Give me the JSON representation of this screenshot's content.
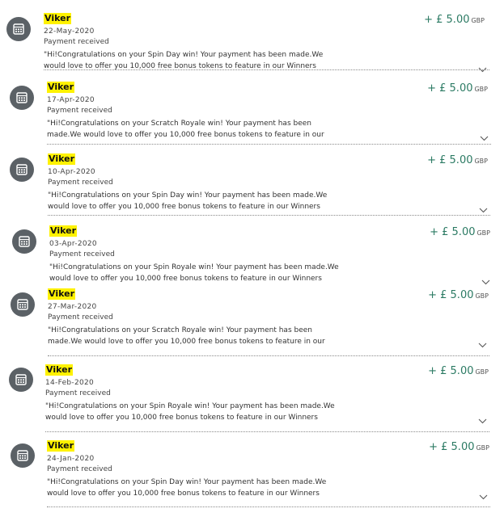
{
  "transactions": [
    {
      "payee": "Viker",
      "date": "22-May-2020",
      "type": "Payment received",
      "amount": "+ £ 5.00",
      "currency": "GBP",
      "message": "\"Hi!Congratulations on your Spin Day win! Your payment has been made.We would love to offer you 10,000 free bonus tokens to feature in our Winners Gallery. How does th..."
    },
    {
      "payee": "Viker",
      "date": "17-Apr-2020",
      "type": "Payment received",
      "amount": "+ £ 5.00",
      "currency": "GBP",
      "message": "\"Hi!Congratulations on your Scratch Royale win! Your payment has been made.We would love to offer you 10,000 free bonus tokens to feature in our Winners Gallery...."
    },
    {
      "payee": "Viker",
      "date": "10-Apr-2020",
      "type": "Payment received",
      "amount": "+ £ 5.00",
      "currency": "GBP",
      "message": "\"Hi!Congratulations on your Spin Day win! Your payment has been made.We would love to offer you 10,000 free bonus tokens to feature in our Winners Gallery. How does th..."
    },
    {
      "payee": "Viker",
      "date": "03-Apr-2020",
      "type": "Payment received",
      "amount": "+ £ 5.00",
      "currency": "GBP",
      "message": "\"Hi!Congratulations on your Spin Royale win! Your payment has been made.We would love to offer you 10,000 free bonus tokens to feature in our Winners Gallery. How do..."
    },
    {
      "payee": "Viker",
      "date": "27-Mar-2020",
      "type": "Payment received",
      "amount": "+ £ 5.00",
      "currency": "GBP",
      "message": "\"Hi!Congratulations on your Scratch Royale win! Your payment has been made.We would love to offer you 10,000 free bonus tokens to feature in our Winners Gallery...."
    },
    {
      "payee": "Viker",
      "date": "14-Feb-2020",
      "type": "Payment received",
      "amount": "+ £ 5.00",
      "currency": "GBP",
      "message": "\"Hi!Congratulations on your Spin Royale win! Your payment has been made.We would love to offer you 10,000 free bonus tokens to feature in our Winners Gallery. How do..."
    },
    {
      "payee": "Viker",
      "date": "24-Jan-2020",
      "type": "Payment received",
      "amount": "+ £ 5.00",
      "currency": "GBP",
      "message": "\"Hi!Congratulations on your Spin Day win! Your payment has been made.We would love to offer you 10,000 free bonus tokens to feature in our Winners Gallery. How does th..."
    }
  ],
  "icons": {
    "transaction": "cash-register-icon",
    "expand": "chevron-down-icon"
  },
  "colors": {
    "amount": "#2b7a63",
    "highlight": "#fff200",
    "icon_bg": "#5b6166"
  }
}
